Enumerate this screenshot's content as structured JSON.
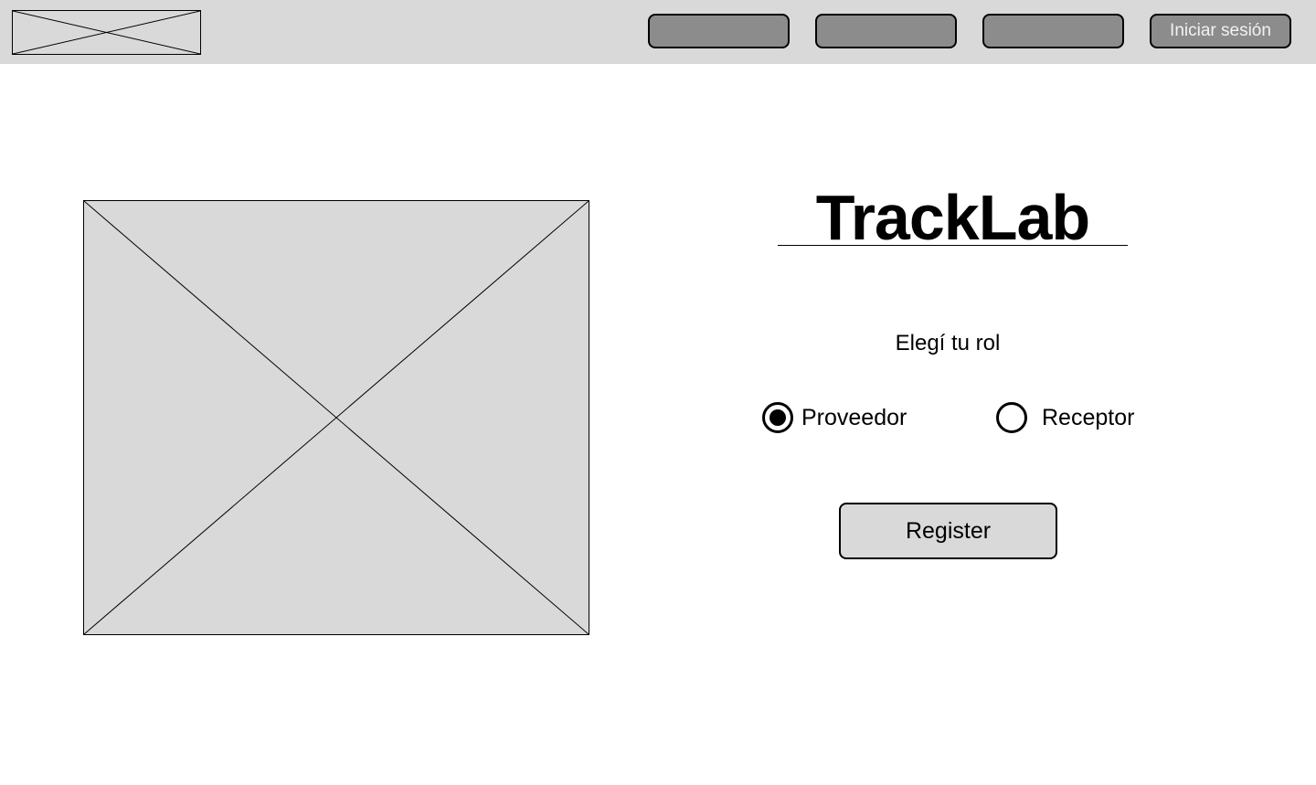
{
  "navbar": {
    "logo_icon": "image-placeholder-icon",
    "buttons": [
      {
        "label": ""
      },
      {
        "label": ""
      },
      {
        "label": ""
      }
    ],
    "login_label": "Iniciar sesión",
    "background_color": "#d9d9d9",
    "button_color": "#8c8c8c"
  },
  "hero": {
    "image_icon": "image-placeholder-icon"
  },
  "brand": {
    "title": "TrackLab"
  },
  "role_selection": {
    "prompt": "Elegí tu rol",
    "options": [
      {
        "label": "Proveedor",
        "checked": true
      },
      {
        "label": "Receptor",
        "checked": false
      }
    ]
  },
  "actions": {
    "register_label": "Register"
  }
}
